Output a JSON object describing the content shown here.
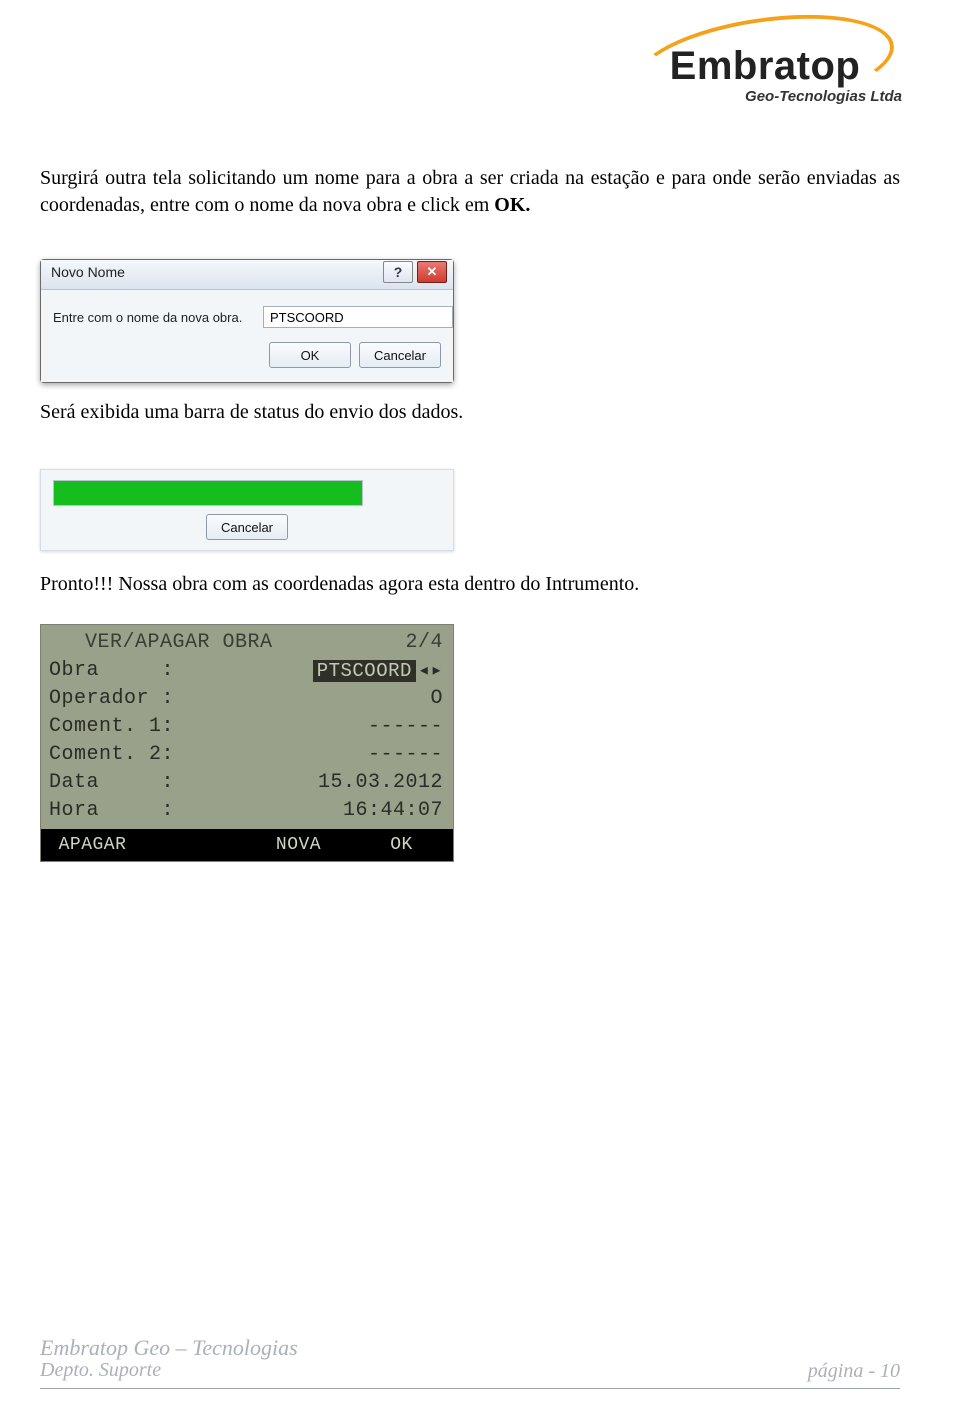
{
  "logo": {
    "brand": "Embratop",
    "tagline": "Geo-Tecnologias Ltda"
  },
  "paragraph1_pre": "Surgirá outra tela solicitando um nome para a obra a ser criada na estação e para onde serão enviadas as coordenadas, entre com o nome da nova obra e click em ",
  "paragraph1_bold": "OK.",
  "dialog1": {
    "title": "Novo Nome",
    "help_glyph": "?",
    "close_glyph": "✕",
    "prompt": "Entre com o nome da nova obra.",
    "input_value": "PTSCOORD",
    "ok": "OK",
    "cancel": "Cancelar"
  },
  "paragraph2": "Será exibida uma barra de status do envio dos dados.",
  "dialog2": {
    "cancel": "Cancelar",
    "progress_pct": 100
  },
  "paragraph3": "Pronto!!! Nossa obra com as coordenadas agora esta dentro do Intrumento.",
  "instrument": {
    "header_title": "VER/APAGAR OBRA",
    "header_page": "2/4",
    "rows": [
      {
        "label": "Obra     :",
        "value": "PTSCOORD",
        "cursor": true,
        "arrows": "◂▸"
      },
      {
        "label": "Operador :",
        "value": "O"
      },
      {
        "label": "Coment. 1:",
        "value": "------"
      },
      {
        "label": "Coment. 2:",
        "value": "------"
      },
      {
        "label": "Data     :",
        "value": "15.03.2012"
      },
      {
        "label": "Hora     :",
        "value": "16:44:07"
      }
    ],
    "softkeys": [
      "APAGAR",
      "",
      "NOVA",
      "OK"
    ]
  },
  "footer": {
    "line1": "Embratop Geo – Tecnologias",
    "line2": "Depto. Suporte",
    "page_label": "página  - 10"
  }
}
